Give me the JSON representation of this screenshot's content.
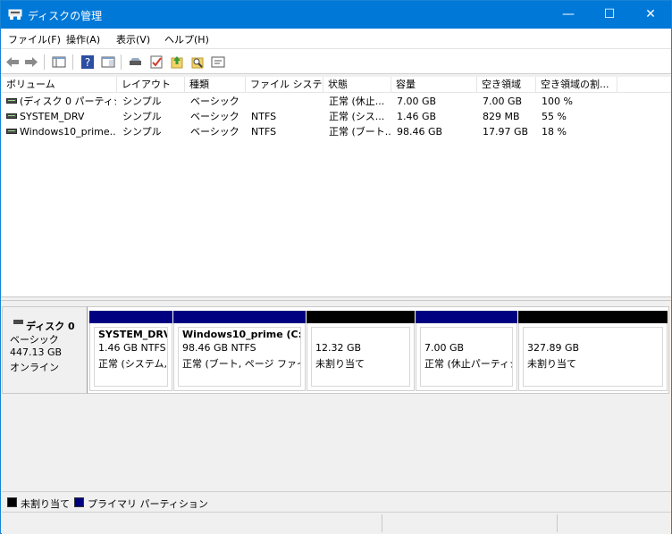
{
  "window": {
    "title": "ディスクの管理",
    "controls": {
      "minimize": "—",
      "maximize": "☐",
      "close": "✕"
    }
  },
  "menu": [
    "ファイル(F)",
    "操作(A)",
    "表示(V)",
    "ヘルプ(H)"
  ],
  "toolbar": {
    "icons": [
      "back-icon",
      "forward-icon",
      "console-tree-icon",
      "help-icon",
      "show-hide-icon",
      "connect-disk-icon",
      "check-icon",
      "export-icon",
      "search-icon",
      "properties-icon"
    ]
  },
  "volume_list": {
    "columns": [
      "ボリューム",
      "レイアウト",
      "種類",
      "ファイル システム",
      "状態",
      "容量",
      "空き領域",
      "空き領域の割..."
    ],
    "rows": [
      [
        "(ディスク 0 パーティシ...",
        "シンプル",
        "ベーシック",
        "",
        "正常 (休止...",
        "7.00 GB",
        "7.00 GB",
        "100 %"
      ],
      [
        "SYSTEM_DRV",
        "シンプル",
        "ベーシック",
        "NTFS",
        "正常 (シス...",
        "1.46 GB",
        "829 MB",
        "55 %"
      ],
      [
        "Windows10_prime...",
        "シンプル",
        "ベーシック",
        "NTFS",
        "正常 (ブート...",
        "98.46 GB",
        "17.97 GB",
        "18 %"
      ]
    ]
  },
  "disk": {
    "name": "ディスク 0",
    "type": "ベーシック",
    "size": "447.13 GB",
    "status": "オンライン",
    "partitions": [
      {
        "name": "SYSTEM_DRV",
        "size": "1.46 GB NTFS",
        "status": "正常 (システム, ア",
        "kind": "primary"
      },
      {
        "name": "Windows10_prime (C:)",
        "size": "98.46 GB NTFS",
        "status": "正常 (ブート, ページ ファイル,",
        "kind": "primary"
      },
      {
        "name": "",
        "size": "12.32 GB",
        "status": "未割り当て",
        "kind": "unallocated"
      },
      {
        "name": "",
        "size": "7.00 GB",
        "status": "正常 (休止パーティシ",
        "kind": "primary"
      },
      {
        "name": "",
        "size": "327.89 GB",
        "status": "未割り当て",
        "kind": "unallocated"
      }
    ]
  },
  "legend": [
    {
      "label": "未割り当て",
      "color": "#000000"
    },
    {
      "label": "プライマリ パーティション",
      "color": "#000080"
    }
  ],
  "colors": {
    "titlebar": "#0078d7",
    "primary_partition": "#000080",
    "unallocated": "#000000"
  }
}
